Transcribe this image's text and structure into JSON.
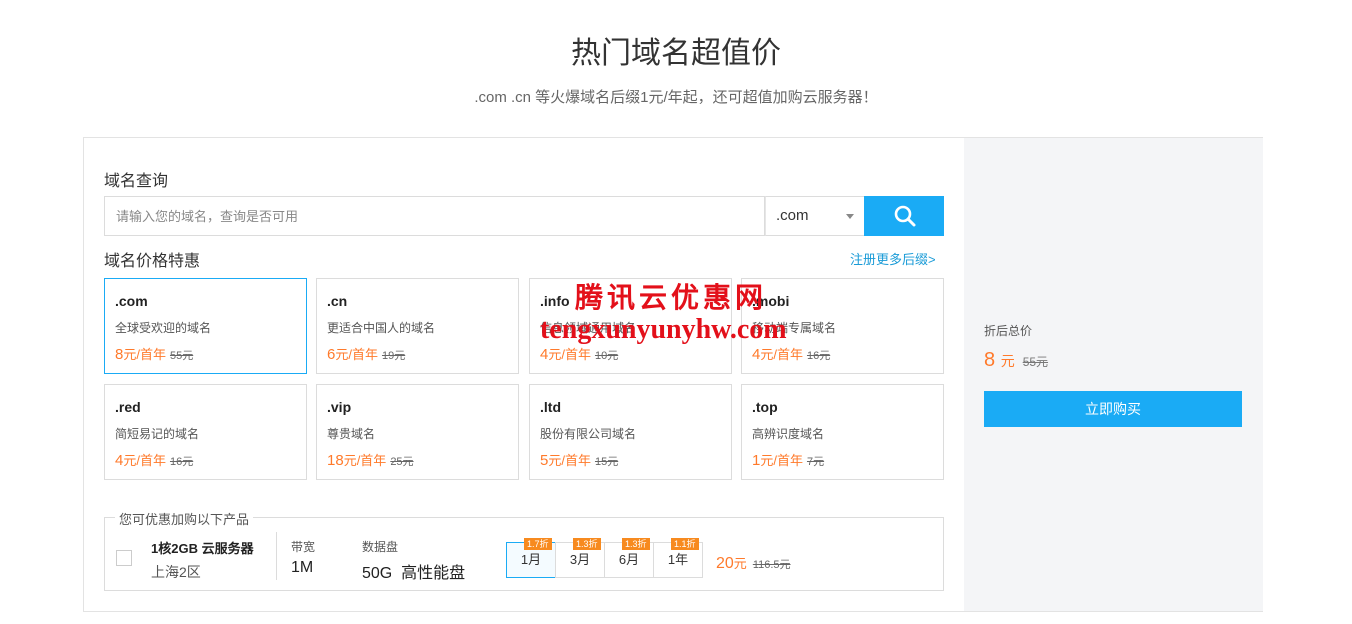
{
  "header": {
    "title": "热门域名超值价",
    "subtitle": ".com .cn 等火爆域名后缀1元/年起，还可超值加购云服务器！"
  },
  "search": {
    "label": "域名查询",
    "placeholder": "请输入您的域名，查询是否可用",
    "suffix_selected": ".com",
    "icon": "search-icon"
  },
  "pricing": {
    "label": "域名价格特惠",
    "more_link": "注册更多后缀>",
    "cards": [
      {
        "suffix": ".com",
        "desc": "全球受欢迎的域名",
        "price": "8",
        "unit": "元/首年",
        "old": "55元"
      },
      {
        "suffix": ".cn",
        "desc": "更适合中国人的域名",
        "price": "6",
        "unit": "元/首年",
        "old": "19元"
      },
      {
        "suffix": ".info",
        "desc": "信息领域通用域名",
        "price": "4",
        "unit": "元/首年",
        "old": "10元"
      },
      {
        "suffix": ".mobi",
        "desc": "移动端专属域名",
        "price": "4",
        "unit": "元/首年",
        "old": "16元"
      },
      {
        "suffix": ".red",
        "desc": "简短易记的域名",
        "price": "4",
        "unit": "元/首年",
        "old": "16元"
      },
      {
        "suffix": ".vip",
        "desc": "尊贵域名",
        "price": "18",
        "unit": "元/首年",
        "old": "25元"
      },
      {
        "suffix": ".ltd",
        "desc": "股份有限公司域名",
        "price": "5",
        "unit": "元/首年",
        "old": "15元"
      },
      {
        "suffix": ".top",
        "desc": "高辨识度域名",
        "price": "1",
        "unit": "元/首年",
        "old": "7元"
      }
    ]
  },
  "addon": {
    "legend": "您可优惠加购以下产品",
    "product_name": "1核2GB 云服务器",
    "region": "上海2区",
    "bandwidth_label": "带宽",
    "bandwidth_value": "1M",
    "disk_label": "数据盘",
    "disk_value": "50G  高性能盘",
    "durations": [
      {
        "label": "1月",
        "discount": "1.7折"
      },
      {
        "label": "3月",
        "discount": "1.3折"
      },
      {
        "label": "6月",
        "discount": "1.3折"
      },
      {
        "label": "1年",
        "discount": "1.1折"
      }
    ],
    "price": "20",
    "unit": "元",
    "old": "116.5元"
  },
  "summary": {
    "label": "折后总价",
    "price": "8",
    "unit": "元",
    "old": "55元",
    "buy_label": "立即购买"
  },
  "watermark": {
    "cn": "腾讯云优惠网",
    "en": "tengxunyunyhw.com"
  },
  "colors": {
    "accent": "#1aabf5",
    "price": "#ff7a2b",
    "discount_tag": "#f78a1f",
    "watermark": "#e3101a",
    "sidebar_bg": "#f4f5f7"
  }
}
